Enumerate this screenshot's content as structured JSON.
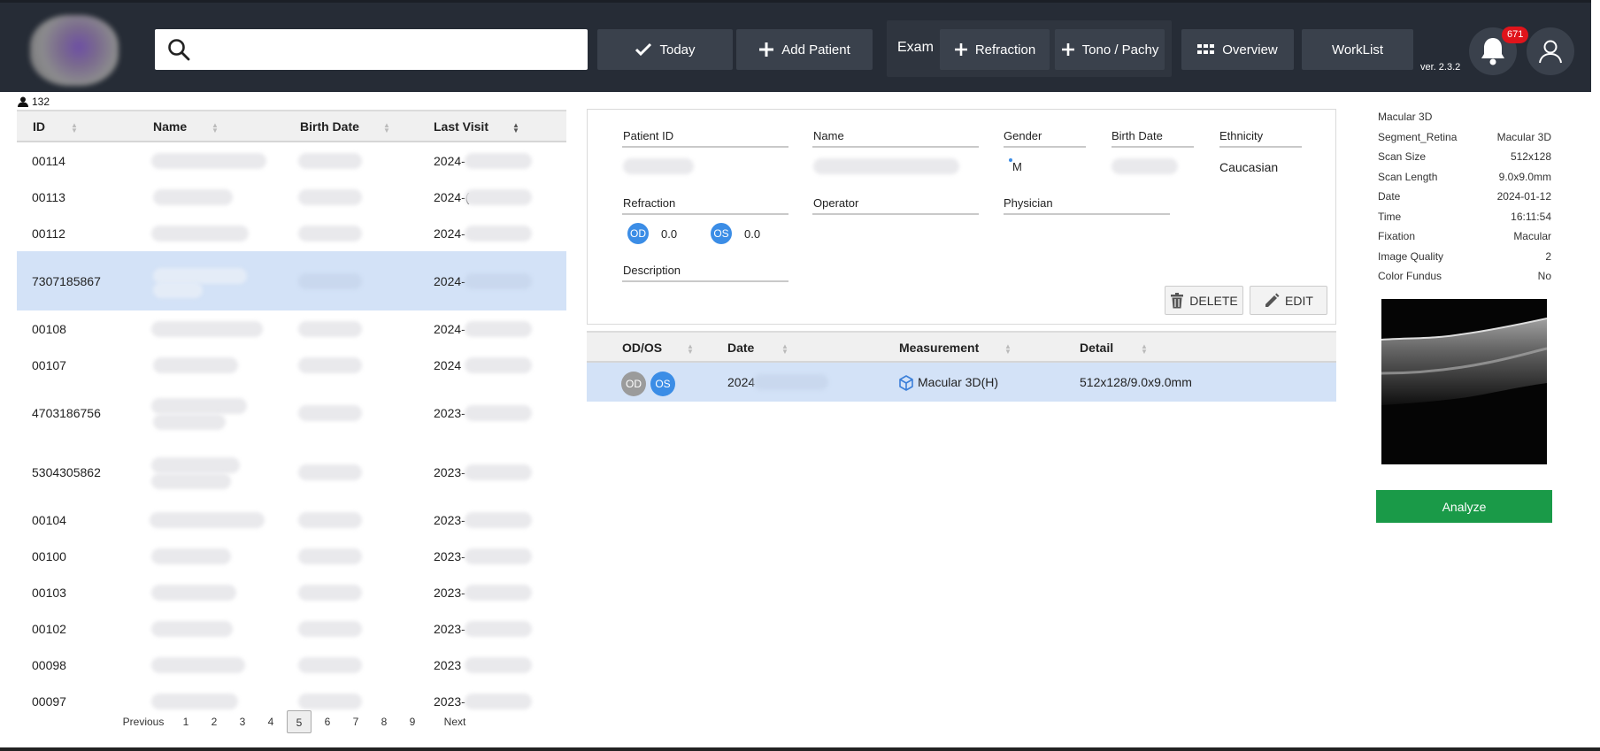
{
  "topbar": {
    "search_placeholder": "",
    "today_label": "Today",
    "add_patient_label": "Add Patient",
    "exam_label": "Exam",
    "refraction_label": "Refraction",
    "tono_label": "Tono / Pachy",
    "overview_label": "Overview",
    "worklist_label": "WorkList",
    "version": "ver. 2.3.2",
    "notification_count": "671"
  },
  "patients": {
    "count": "132",
    "columns": [
      "ID",
      "Name",
      "Birth Date",
      "Last Visit"
    ],
    "rows": [
      {
        "id": "00114",
        "last_visit": "2024-"
      },
      {
        "id": "00113",
        "last_visit": "2024-("
      },
      {
        "id": "00112",
        "last_visit": "2024-"
      },
      {
        "id": "7307185867",
        "last_visit": "2024-"
      },
      {
        "id": "00108",
        "last_visit": "2024-"
      },
      {
        "id": "00107",
        "last_visit": "2024"
      },
      {
        "id": "4703186756",
        "last_visit": "2023-"
      },
      {
        "id": "5304305862",
        "last_visit": "2023-"
      },
      {
        "id": "00104",
        "last_visit": "2023-"
      },
      {
        "id": "00100",
        "last_visit": "2023-"
      },
      {
        "id": "00103",
        "last_visit": "2023-"
      },
      {
        "id": "00102",
        "last_visit": "2023-"
      },
      {
        "id": "00098",
        "last_visit": "2023"
      },
      {
        "id": "00097",
        "last_visit": "2023-"
      }
    ],
    "selected_index": 3,
    "pager": {
      "previous": "Previous",
      "pages": [
        "1",
        "2",
        "3",
        "4",
        "5",
        "6",
        "7",
        "8",
        "9"
      ],
      "current": "5",
      "next": "Next"
    }
  },
  "detail": {
    "patient_id_label": "Patient ID",
    "name_label": "Name",
    "gender_label": "Gender",
    "gender_value": "M",
    "birth_date_label": "Birth Date",
    "ethnicity_label": "Ethnicity",
    "ethnicity_value": "Caucasian",
    "refraction_label": "Refraction",
    "od_label": "OD",
    "od_value": "0.0",
    "os_label": "OS",
    "os_value": "0.0",
    "operator_label": "Operator",
    "physician_label": "Physician",
    "description_label": "Description",
    "delete_label": "DELETE",
    "edit_label": "EDIT"
  },
  "measurements": {
    "columns": [
      "OD/OS",
      "Date",
      "Measurement",
      "Detail"
    ],
    "row": {
      "od": "OD",
      "os": "OS",
      "date": "2024",
      "measurement": "Macular 3D(H)",
      "detail": "512x128/9.0x9.0mm"
    }
  },
  "scan_info": {
    "title": "Macular 3D",
    "rows": [
      {
        "k": "Segment_Retina",
        "v": "Macular 3D"
      },
      {
        "k": "Scan Size",
        "v": "512x128"
      },
      {
        "k": "Scan Length",
        "v": "9.0x9.0mm"
      },
      {
        "k": "Date",
        "v": "2024-01-12"
      },
      {
        "k": "Time",
        "v": "16:11:54"
      },
      {
        "k": "Fixation",
        "v": "Macular"
      },
      {
        "k": "Image Quality",
        "v": "2"
      },
      {
        "k": "Color Fundus",
        "v": "No"
      }
    ],
    "analyze_label": "Analyze"
  },
  "colors": {
    "topbar": "#262c36",
    "button": "#3a414c",
    "selected_row": "#d3e2f7",
    "eye_blue": "#3b8de6",
    "analyze": "#1a9a48",
    "badge": "#e0141b"
  }
}
